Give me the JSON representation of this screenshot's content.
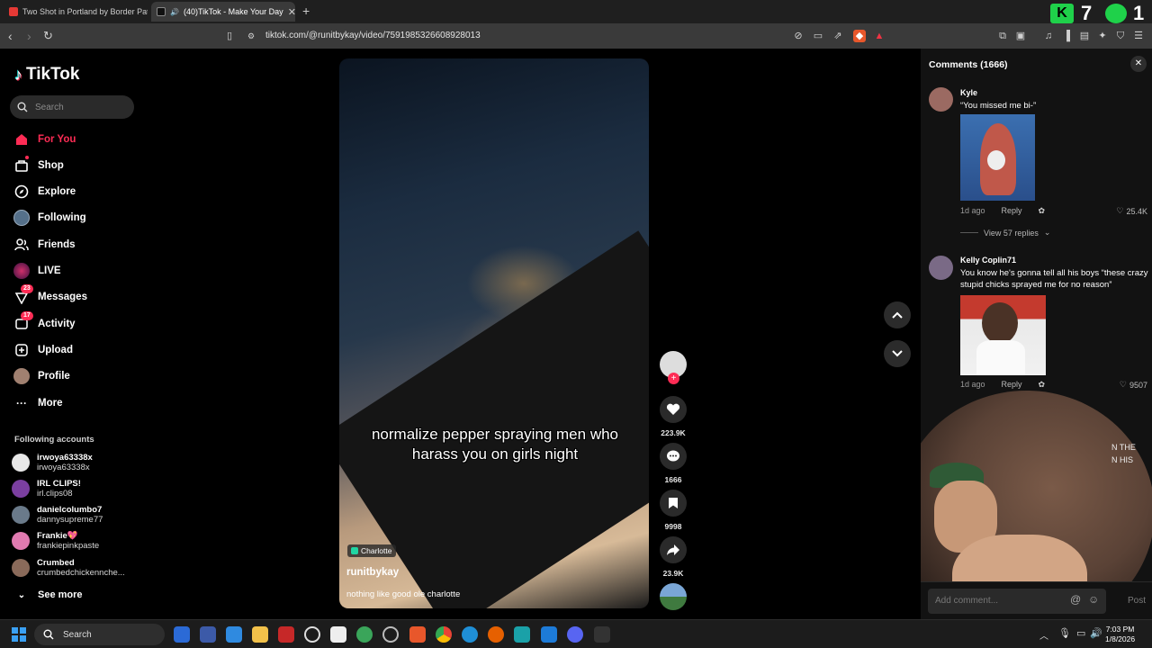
{
  "browser": {
    "tabs": [
      {
        "title": "Two Shot in Portland by Border Patro",
        "favicon_color": "#e53935"
      },
      {
        "title": "(40)TikTok - Make Your Day",
        "favicon_color": "#111111"
      }
    ],
    "url": "tiktok.com/@runitbykay/video/7591985326608928013",
    "overlay_counter_left": "7",
    "overlay_counter_right": "1"
  },
  "sidebar": {
    "logo": "TikTok",
    "search_placeholder": "Search",
    "nav": [
      {
        "label": "For You",
        "icon": "home-icon",
        "active": true
      },
      {
        "label": "Shop",
        "icon": "shop-icon"
      },
      {
        "label": "Explore",
        "icon": "compass-icon"
      },
      {
        "label": "Following",
        "icon": "following-avatar-icon"
      },
      {
        "label": "Friends",
        "icon": "friends-icon"
      },
      {
        "label": "LIVE",
        "icon": "live-icon"
      },
      {
        "label": "Messages",
        "icon": "messages-icon",
        "badge": "23"
      },
      {
        "label": "Activity",
        "icon": "activity-icon",
        "badge": "17"
      },
      {
        "label": "Upload",
        "icon": "upload-icon"
      },
      {
        "label": "Profile",
        "icon": "profile-avatar-icon"
      },
      {
        "label": "More",
        "icon": "more-icon"
      }
    ],
    "following_title": "Following accounts",
    "following": [
      {
        "name": "irwoya63338x",
        "username": "irwoya63338x",
        "color": "#e8e8e8"
      },
      {
        "name": "IRL CLIPS!",
        "username": "irl.clips08",
        "color": "#7b3fa0"
      },
      {
        "name": "danielcolumbo7",
        "username": "dannysupreme77",
        "color": "#6a7a8a"
      },
      {
        "name": "Frankie💖",
        "username": "frankiepinkpaste",
        "color": "#e07ab0"
      },
      {
        "name": "Crumbed",
        "username": "crumbedchickennche...",
        "color": "#8a6a5a"
      }
    ],
    "see_more": "See more"
  },
  "video": {
    "caption": "normalize pepper spraying men who harass you on girls night",
    "location": "Charlotte",
    "author": "runitbykay",
    "description": "nothing like good ole charlotte",
    "likes": "223.9K",
    "comments": "1666",
    "saves": "9998",
    "shares": "23.9K"
  },
  "comments_panel": {
    "title": "Comments (1666)",
    "comments": [
      {
        "name": "Kyle",
        "text": "“You missed me bi-”",
        "age": "1d ago",
        "reply": "Reply",
        "likes": "25.4K",
        "view_replies": "View 57 replies"
      },
      {
        "name": "Kelly Coplin71",
        "text": "You know he's gonna tell all his boys “these crazy stupid chicks sprayed me for no reason”",
        "age": "1d ago",
        "reply": "Reply",
        "likes": "9507"
      }
    ],
    "overlay_text_1": "N THE",
    "overlay_text_2": "N HIS",
    "input_placeholder": "Add comment...",
    "post_label": "Post"
  },
  "taskbar": {
    "search_label": "Search",
    "time": "7:03 PM",
    "date": "1/8/2026"
  },
  "colors": {
    "accent": "#fe2c55",
    "browser_bg": "#3a3a3a",
    "tab_bar": "#1f1f1f"
  }
}
